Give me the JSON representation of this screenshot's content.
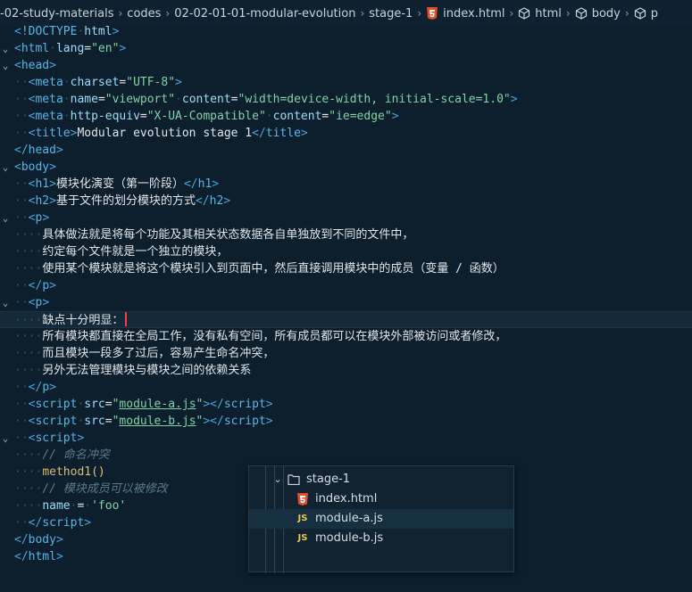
{
  "breadcrumb": {
    "items": [
      "-02-study-materials",
      "codes",
      "02-02-01-01-modular-evolution",
      "stage-1",
      "index.html",
      "html",
      "body",
      "p"
    ],
    "icons": [
      "",
      "",
      "",
      "",
      "html5-icon",
      "cube-icon",
      "cube-icon",
      "cube-icon"
    ]
  },
  "code": {
    "doctype": "!DOCTYPE",
    "doctype_name": "html",
    "html_lang_val": "\"en\"",
    "meta_charset_val": "\"UTF-8\"",
    "meta_viewport_val1": "\"viewport\"",
    "meta_viewport_val2": "\"width=device-width, initial-scale=1.0\"",
    "meta_http_val1": "\"X-UA-Compatible\"",
    "meta_http_val2": "\"ie=edge\"",
    "title_text": "Modular evolution stage 1",
    "h1_text": "模块化演变（第一阶段）",
    "h2_text": "基于文件的划分模块的方式",
    "p1_lines": [
      "具体做法就是将每个功能及其相关状态数据各自单独放到不同的文件中，",
      "约定每个文件就是一个独立的模块，",
      "使用某个模块就是将这个模块引入到页面中，然后直接调用模块中的成员（变量 / 函数）"
    ],
    "p2_lines": [
      "缺点十分明显：",
      "所有模块都直接在全局工作，没有私有空间，所有成员都可以在模块外部被访问或者修改，",
      "而且模块一段多了过后，容易产生命名冲突，",
      "另外无法管理模块与模块之间的依赖关系"
    ],
    "script_src_a": "module-a.js",
    "script_src_b": "module-b.js",
    "comment1": "// 命名冲突",
    "call": "method1",
    "comment2": "// 模块成员可以被修改",
    "assign_name": "name",
    "assign_val": "'foo'"
  },
  "explorer": {
    "folder": "stage-1",
    "files": [
      {
        "name": "index.html",
        "icon": "html5-icon"
      },
      {
        "name": "module-a.js",
        "icon": "js-icon"
      },
      {
        "name": "module-b.js",
        "icon": "js-icon"
      }
    ],
    "js_label": "JS"
  },
  "colors": {
    "background": "#0d1e2c",
    "tag": "#4aa3d8",
    "string": "#7fd3a8",
    "html5": "#e44d26",
    "js": "#e5c84f"
  }
}
